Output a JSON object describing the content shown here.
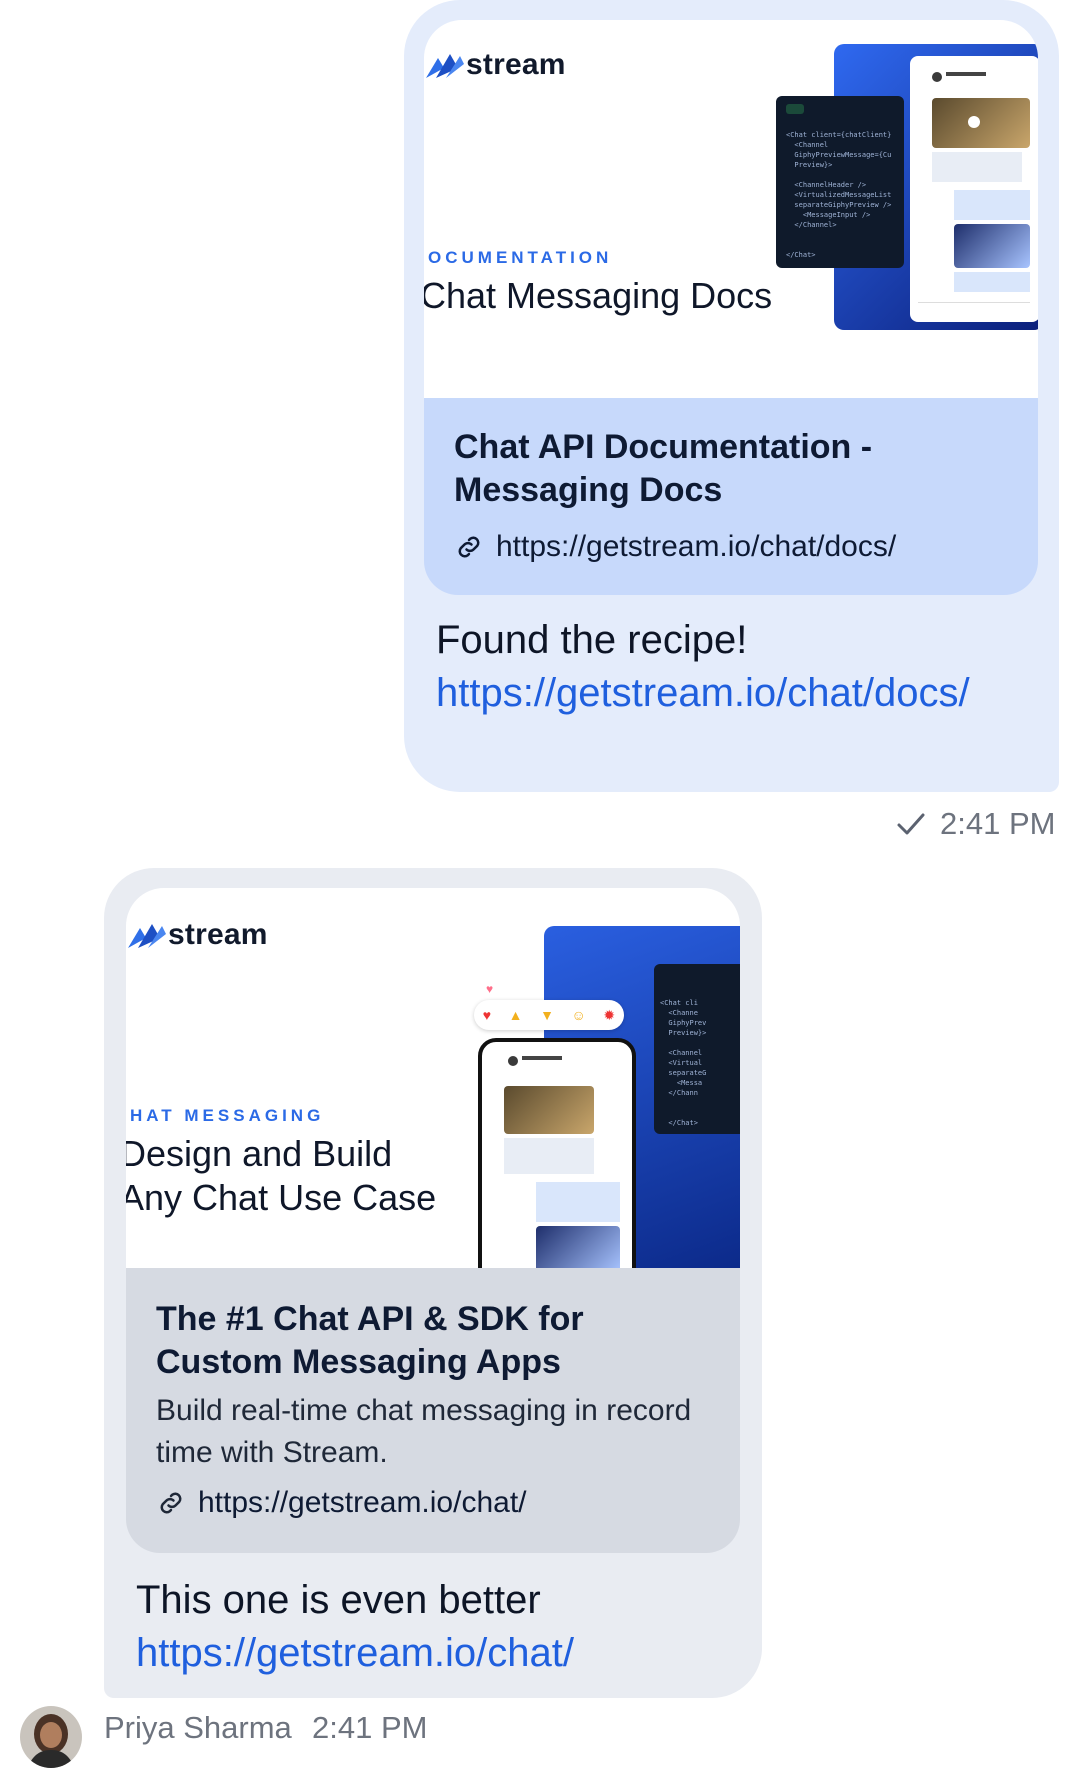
{
  "outgoing": {
    "card": {
      "logo_text": "stream",
      "image_kicker": "OCUMENTATION",
      "image_headline": "Chat Messaging Docs",
      "code_lines": [
        "<Chat client={chatClient}",
        "  <Channel",
        "  GiphyPreviewMessage={Cu",
        "  Preview}>",
        "",
        "  <ChannelHeader />",
        "  <VirtualizedMessageList",
        "  separateGiphyPreview />",
        "    <MessageInput />",
        "  </Channel>",
        "",
        "",
        "</Chat>"
      ],
      "title": "Chat API Documentation - Messaging Docs",
      "url": "https://getstream.io/chat/docs/"
    },
    "text": "Found the recipe!",
    "link": "https://getstream.io/chat/docs/",
    "status": {
      "icon": "checkmark-icon",
      "time": "2:41 PM"
    }
  },
  "incoming": {
    "card": {
      "logo_text": "stream",
      "image_kicker": "HAT MESSAGING",
      "image_headline_1": "Design and Build",
      "image_headline_2": "Any Chat Use Case",
      "title": "The #1 Chat API & SDK for Custom Messaging Apps",
      "description": "Build real-time chat messaging in record time with Stream.",
      "url": "https://getstream.io/chat/"
    },
    "text": "This one is even better",
    "link": "https://getstream.io/chat/",
    "author": "Priya Sharma",
    "time": "2:41 PM"
  },
  "colors": {
    "outgoing_bubble": "#e4ecfb",
    "incoming_bubble": "#e9ecf2",
    "link": "#1f5fde",
    "accent": "#2b6ae6"
  }
}
